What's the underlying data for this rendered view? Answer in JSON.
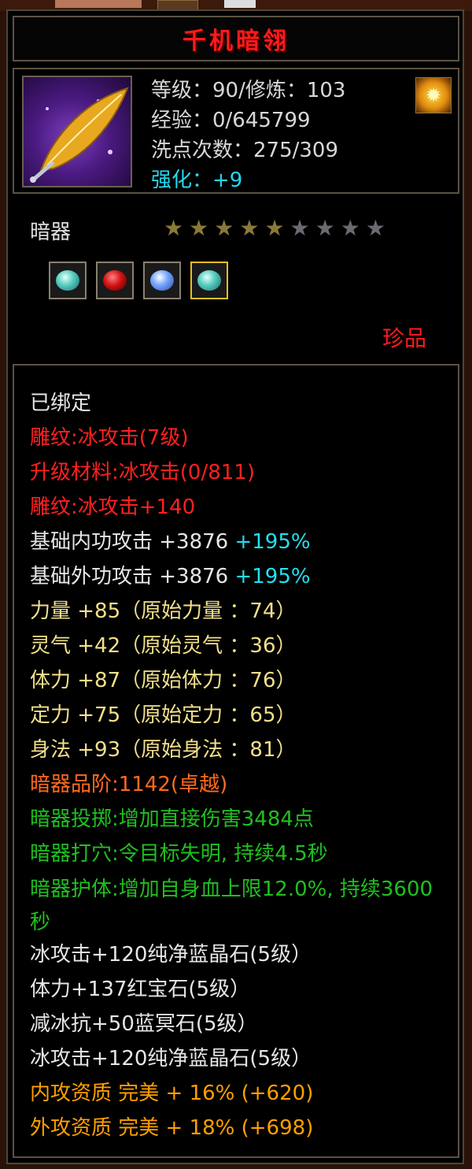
{
  "item": {
    "name": "千机暗翎",
    "type": "暗器",
    "rarity": "珍品",
    "level_line": "等级：90/修炼：103",
    "exp_line": "经验：0/645799",
    "wash_line": "洗点次数：275/309",
    "enhance_line": "强化：+9",
    "stars": {
      "filled": 5,
      "total": 9
    }
  },
  "gems": [
    {
      "kind": "blue-crystal"
    },
    {
      "kind": "ruby"
    },
    {
      "kind": "blue-gem"
    },
    {
      "kind": "blue-crystal",
      "selected": true
    }
  ],
  "attributes": {
    "bound": "已绑定",
    "engrave1": "雕纹:冰攻击(7级)",
    "upgrade_material": "升级材料:冰攻击(0/811)",
    "engrave2": "雕纹:冰攻击+140",
    "inner_attack": {
      "text": "基础内功攻击 +3876",
      "bonus": "+195%"
    },
    "outer_attack": {
      "text": "基础外功攻击 +3876",
      "bonus": "+195%"
    },
    "strength": "力量 +85（原始力量  ：74）",
    "spirit": "灵气 +42（原始灵气  ：36）",
    "stamina": "体力 +87（原始体力  ：76）",
    "focus": "定力 +75（原始定力  ：65）",
    "agility": "身法 +93（原始身法  ：81）",
    "grade": "暗器品阶:1142(卓越)",
    "throw": "暗器投掷:增加直接伤害3484点",
    "acupoint": "暗器打穴:令目标失明, 持续4.5秒",
    "guard": "暗器护体:增加自身血上限12.0%, 持续3600秒",
    "gem1": "冰攻击+120纯净蓝晶石(5级）",
    "gem2": "体力+137红宝石(5级）",
    "gem3": "减冰抗+50蓝冥石(5级）",
    "gem4": "冰攻击+120纯净蓝晶石(5级）",
    "inner_quality": "内攻资质  完美  +  16%  (+620)",
    "outer_quality": "外攻资质  完美  +  18%  (+698)"
  },
  "colors": {
    "title": "#ff1a1a",
    "rarity": "#ff1a1a",
    "enhance": "#24d8f0",
    "attribute_bonus": "#22e0f0",
    "engrave": "#ff2020",
    "stat": "#f2e08a",
    "grade": "#ff6a20",
    "skill": "#1fc01f",
    "quality": "#ffa000"
  }
}
